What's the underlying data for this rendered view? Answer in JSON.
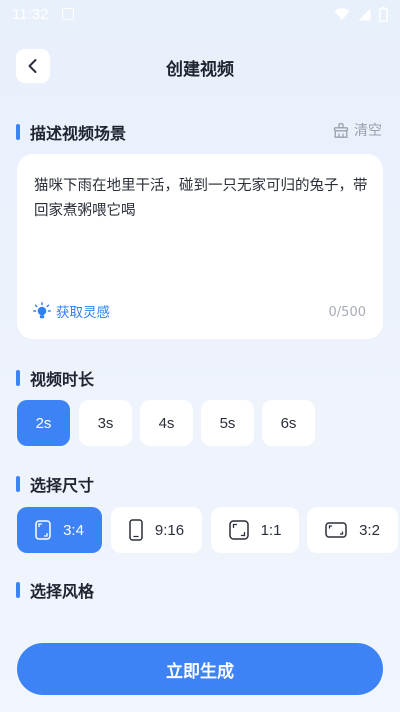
{
  "status_bar": {
    "time": "11:32"
  },
  "header": {
    "title": "创建视频"
  },
  "scene": {
    "title": "描述视频场景",
    "clear_label": "清空",
    "text": "猫咪下雨在地里干活，碰到一只无家可归的兔子，带回家煮粥喂它喝",
    "inspire_label": "获取灵感",
    "counter": "0/500"
  },
  "duration": {
    "title": "视频时长",
    "options": [
      "2s",
      "3s",
      "4s",
      "5s",
      "6s"
    ],
    "selected": "2s"
  },
  "size": {
    "title": "选择尺寸",
    "options": [
      "3:4",
      "9:16",
      "1:1",
      "3:2"
    ],
    "selected": "3:4"
  },
  "style": {
    "title": "选择风格"
  },
  "submit_label": "立即生成",
  "colors": {
    "accent": "#3d83f6",
    "link": "#2f80f0",
    "background": "#eaf1fc"
  },
  "icons": [
    "back-icon",
    "broom-icon",
    "lightbulb-icon",
    "wifi-icon",
    "signal-icon",
    "battery-icon"
  ]
}
